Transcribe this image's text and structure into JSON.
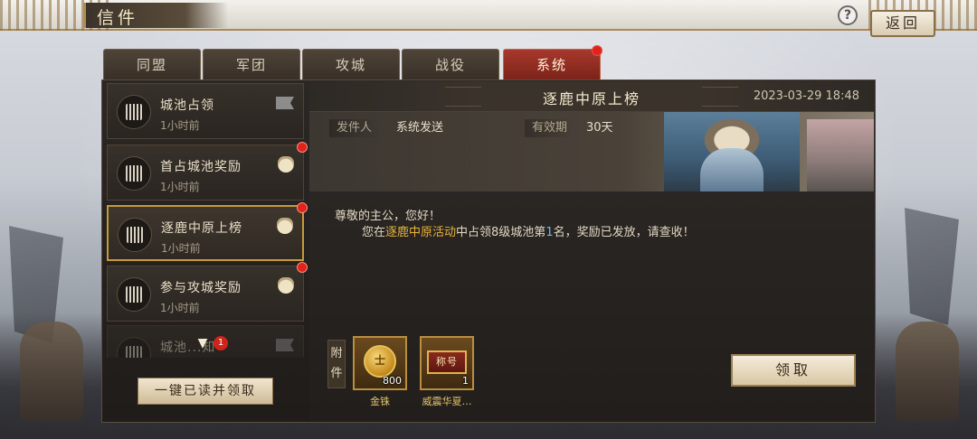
{
  "header": {
    "title": "信件",
    "help_label": "?",
    "back_label": "返回"
  },
  "tabs": [
    {
      "label": "同盟",
      "active": false
    },
    {
      "label": "军团",
      "active": false
    },
    {
      "label": "攻城",
      "active": false
    },
    {
      "label": "战役",
      "active": false
    },
    {
      "label": "系统",
      "active": true,
      "has_notification": true
    }
  ],
  "mail_list": {
    "items": [
      {
        "title": "城池占领",
        "time": "1小时前",
        "icon": "flag-icon",
        "unread": false,
        "selected": false
      },
      {
        "title": "首占城池奖励",
        "time": "1小时前",
        "icon": "reward-bag-icon",
        "unread": true,
        "selected": false
      },
      {
        "title": "逐鹿中原上榜",
        "time": "1小时前",
        "icon": "reward-bag-icon",
        "unread": true,
        "selected": true
      },
      {
        "title": "参与攻城奖励",
        "time": "1小时前",
        "icon": "reward-bag-icon",
        "unread": true,
        "selected": false
      },
      {
        "title": "城池...知",
        "time": "",
        "icon": "flag-icon",
        "unread": false,
        "selected": false
      }
    ],
    "more_count": "1",
    "read_all_label": "一键已读并领取"
  },
  "detail": {
    "title": "逐鹿中原上榜",
    "date": "2023-03-29  18:48",
    "sender_label": "发件人",
    "sender_value": "系统发送",
    "validity_label": "有效期",
    "validity_value": "30天",
    "greeting": "尊敬的主公，您好！",
    "message_prefix": "您在",
    "message_event": "逐鹿中原活动",
    "message_middle": "中占领8级城池第",
    "message_rank": "1",
    "message_suffix": "名，奖励已发放，请查收！",
    "attachment_label": "附件",
    "attachments": [
      {
        "name": "金铢",
        "quantity": "800",
        "icon": "gold-coin-icon",
        "icon_text": "士"
      },
      {
        "name": "威震华夏…",
        "quantity": "1",
        "icon": "title-plaque-icon",
        "icon_text": "称号"
      }
    ],
    "claim_label": "领取"
  },
  "colors": {
    "accent_red": "#a8382c",
    "highlight_gold": "#e6b33a",
    "highlight_blue": "#6fb6ea",
    "notification_red": "#e0231b"
  }
}
